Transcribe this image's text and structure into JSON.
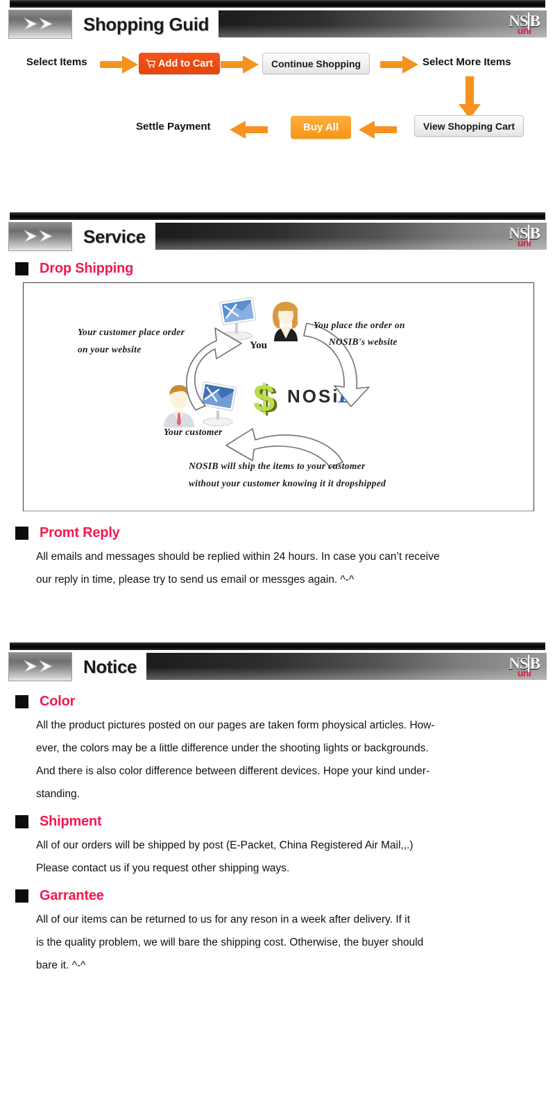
{
  "brand": {
    "logo_main": "NSB",
    "logo_main_part1": "NS",
    "logo_main_part2": "B",
    "logo_sub": "uni",
    "logo_sub_color": "#d81c3f"
  },
  "sections": [
    {
      "id": "shopping-guid",
      "title": "Shopping Guid",
      "chevron": "double-chevron-right-icon"
    },
    {
      "id": "service",
      "title": "Service",
      "chevron": "double-chevron-right-icon"
    },
    {
      "id": "notice",
      "title": "Notice",
      "chevron": "double-chevron-right-icon"
    }
  ],
  "shopping_flow": {
    "step_select_items": "Select Items",
    "btn_add_to_cart": "Add to Cart",
    "btn_add_to_cart_icon": "shopping-cart-icon",
    "btn_continue_shopping": "Continue Shopping",
    "step_select_more_items": "Select More Items",
    "btn_view_shopping_cart": "View Shopping Cart",
    "btn_buy_all": "Buy All",
    "step_settle_payment": "Settle Payment",
    "arrow_color": "#f6921e",
    "add_to_cart_color": "#ef4c12",
    "buy_all_color": "#f9a02b"
  },
  "service": {
    "drop_shipping": {
      "heading": "Drop Shipping",
      "label_you": "You",
      "label_your_customer": "Your customer",
      "note_customer_order_line1": "Your customer place order",
      "note_customer_order_line2": "on your website",
      "note_place_order_line1": "You place the order on",
      "note_place_order_line2": "NOSIB's website",
      "note_ship_line1": "NOSIB will ship the items to your customer",
      "note_ship_line2": "without your customer knowing it it dropshipped",
      "diagram_logo_text": "NOSi",
      "diagram_logo_mark": "B",
      "money_icon": "dollar-sign-icon",
      "you_icon": "woman-with-monitor-icon",
      "customer_icon": "man-with-monitor-icon"
    },
    "prompt_reply": {
      "heading": "Promt Reply",
      "line1": "All emails and messages should be replied within 24 hours. In case you can’t receive",
      "line2": "our reply in time, please try to send us email or messges again. ^-^"
    }
  },
  "notice": {
    "color": {
      "heading": "Color",
      "line1": "All the product pictures posted on our pages are taken form phoysical articles. How-",
      "line2": "ever, the colors may be a little difference under the shooting lights or backgrounds.",
      "line3": "And there is also color difference between different devices. Hope your kind under-",
      "line4": "standing."
    },
    "shipment": {
      "heading": "Shipment",
      "line1": "All of our orders will be shipped by post (E-Packet, China Registered Air Mail,,.)",
      "line2": "Please contact us if you request other shipping ways."
    },
    "garrantee": {
      "heading": "Garrantee",
      "line1": "All of our items can be returned to us for any reson in a week after delivery. If it",
      "line2": "is the quality problem, we will bare the shipping cost. Otherwise, the buyer should",
      "line3": "bare it. ^-^"
    }
  },
  "theme": {
    "heading_pink": "#f2194f",
    "bullet_black": "#0d0d0d",
    "text_black": "#111111"
  }
}
